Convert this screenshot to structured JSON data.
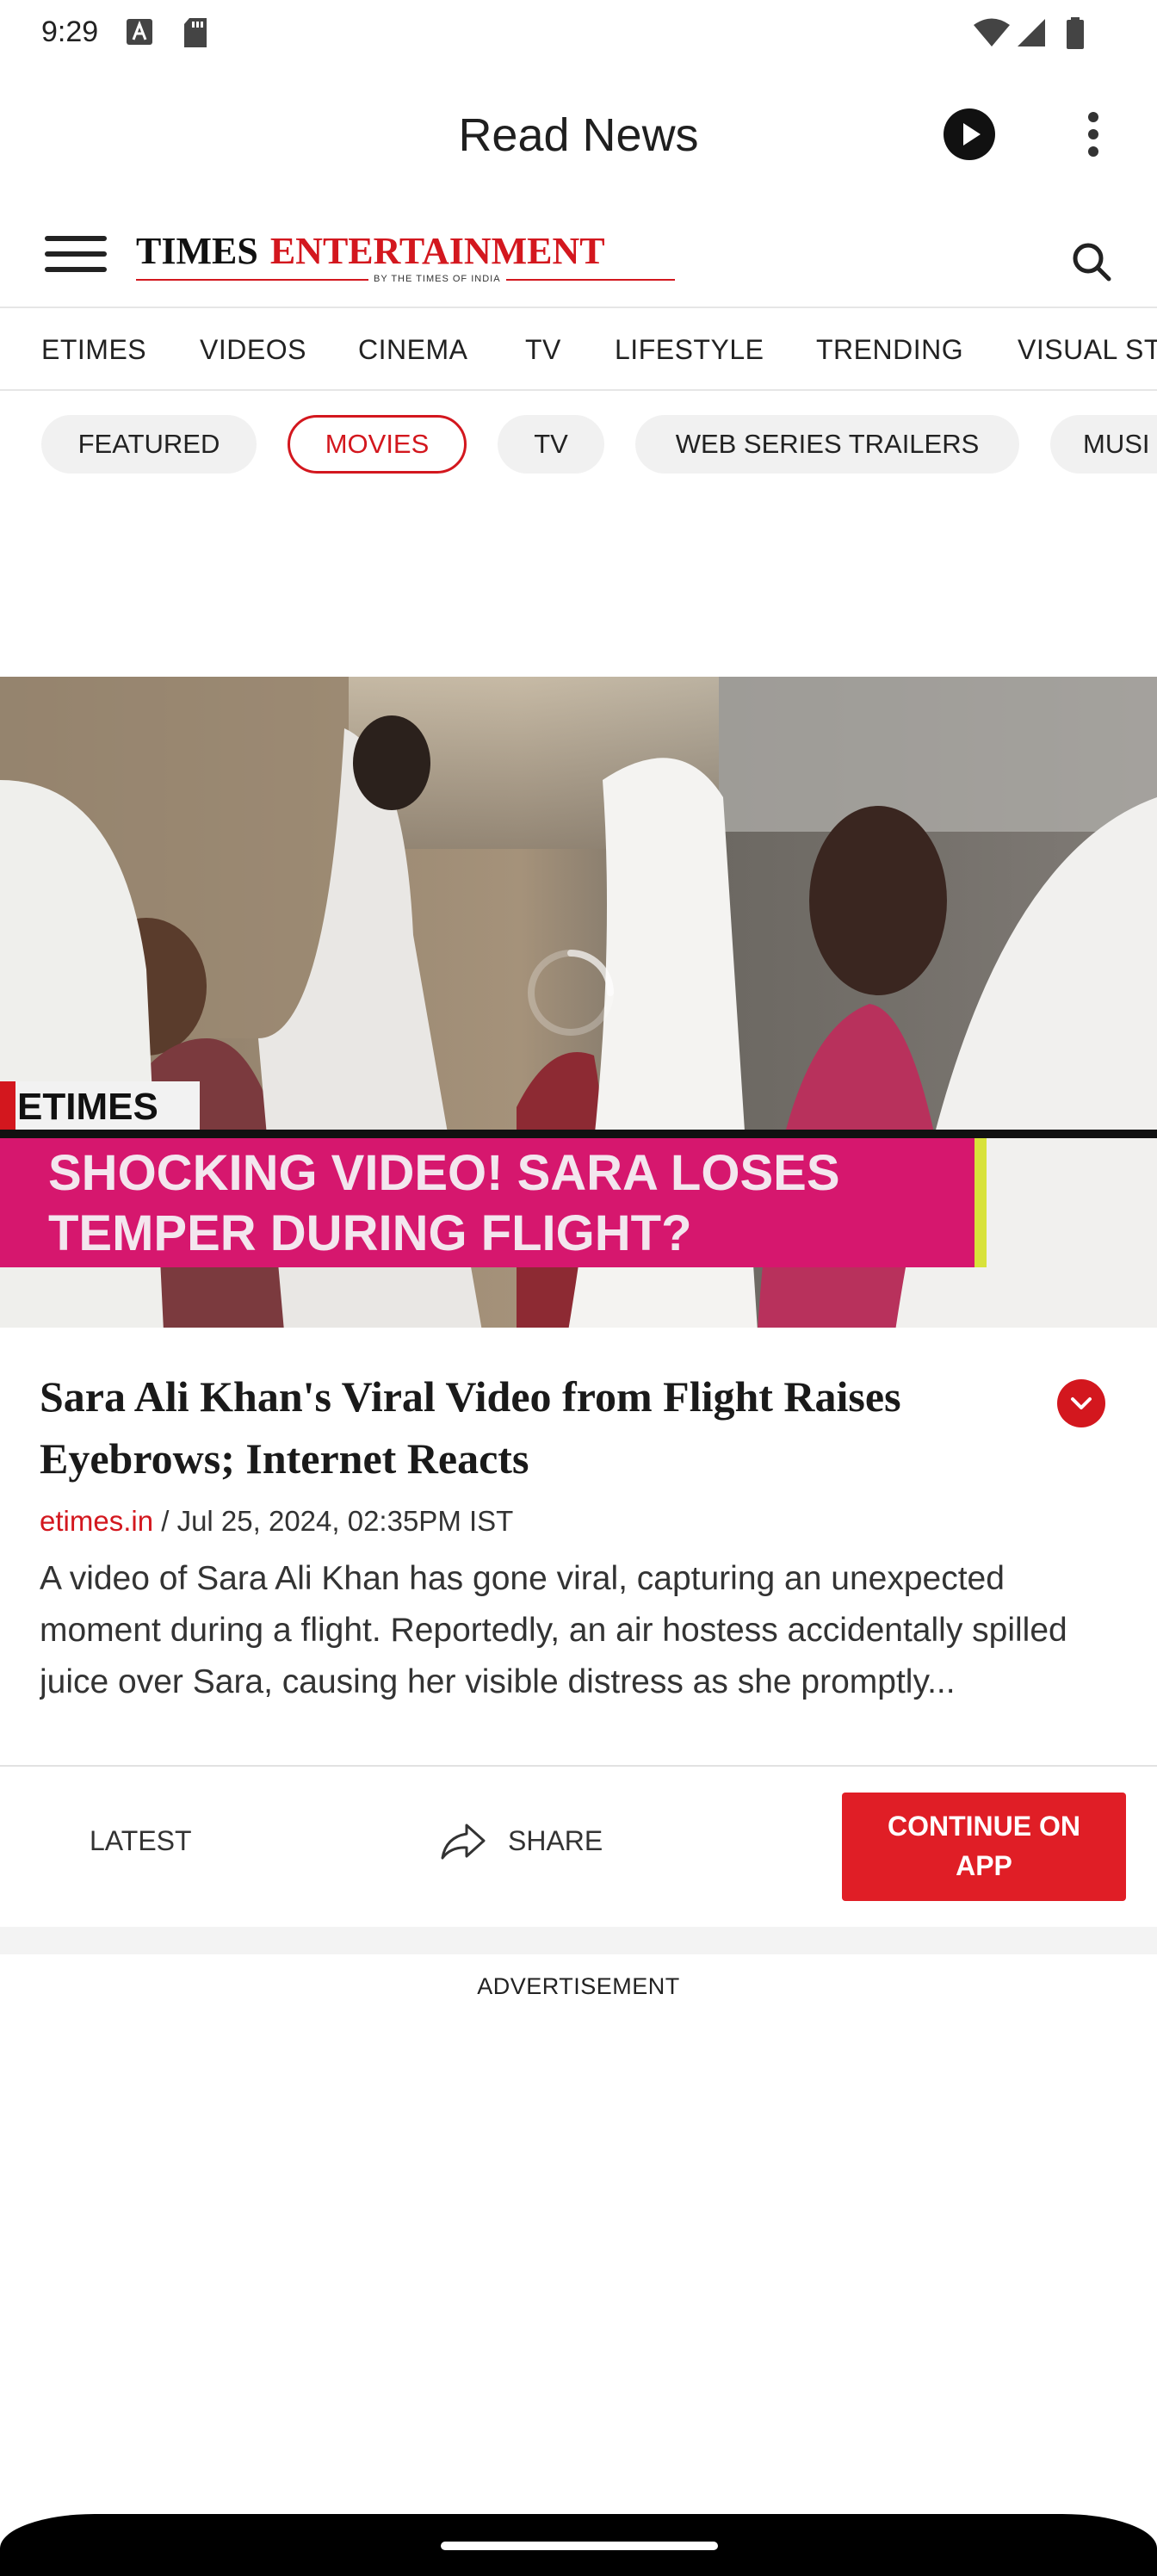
{
  "status_bar": {
    "time": "9:29",
    "icons": [
      "notification-a-icon",
      "sd-card-icon",
      "wifi-icon",
      "signal-icon",
      "battery-icon"
    ]
  },
  "app_bar": {
    "title": "Read News",
    "play_icon": "play-icon",
    "menu_icon": "more-vert-icon"
  },
  "site_header": {
    "logo_word_1": "TIMES",
    "logo_word_2": "ENTERTAINMENT",
    "logo_tagline": "BY THE TIMES OF INDIA",
    "menu_icon": "hamburger-icon",
    "search_icon": "search-icon"
  },
  "nav_tabs": [
    "ETIMES",
    "VIDEOS",
    "CINEMA",
    "TV",
    "LIFESTYLE",
    "TRENDING",
    "VISUAL ST"
  ],
  "chips": [
    {
      "label": "FEATURED",
      "active": false
    },
    {
      "label": "MOVIES",
      "active": true
    },
    {
      "label": "TV",
      "active": false
    },
    {
      "label": "WEB SERIES TRAILERS",
      "active": false
    },
    {
      "label": "MUSI",
      "active": false
    }
  ],
  "video": {
    "brand_tag": "ETIMES",
    "caption_line_1": "SHOCKING VIDEO! SARA LOSES",
    "caption_line_2": "TEMPER DURING FLIGHT?",
    "loading": true
  },
  "article": {
    "headline": "Sara Ali Khan's Viral Video from Flight Raises Eyebrows; Internet Reacts",
    "source": "etimes.in",
    "separator": " / ",
    "date": "Jul 25, 2024, 02:35PM IST",
    "summary": "A video of Sara Ali Khan has gone viral, capturing an unexpected moment during a flight. Reportedly, an air hostess accidentally spilled juice over Sara, causing her visible distress as she promptly..."
  },
  "actions": {
    "latest_label": "LATEST",
    "share_label": "SHARE",
    "continue_label_1": "CONTINUE ON",
    "continue_label_2": "APP"
  },
  "ad_label": "ADVERTISEMENT",
  "colors": {
    "brand_red": "#d3171e",
    "button_red": "#e01e26",
    "caption_magenta": "#d6176e",
    "caption_yellow": "#d8e23a"
  }
}
